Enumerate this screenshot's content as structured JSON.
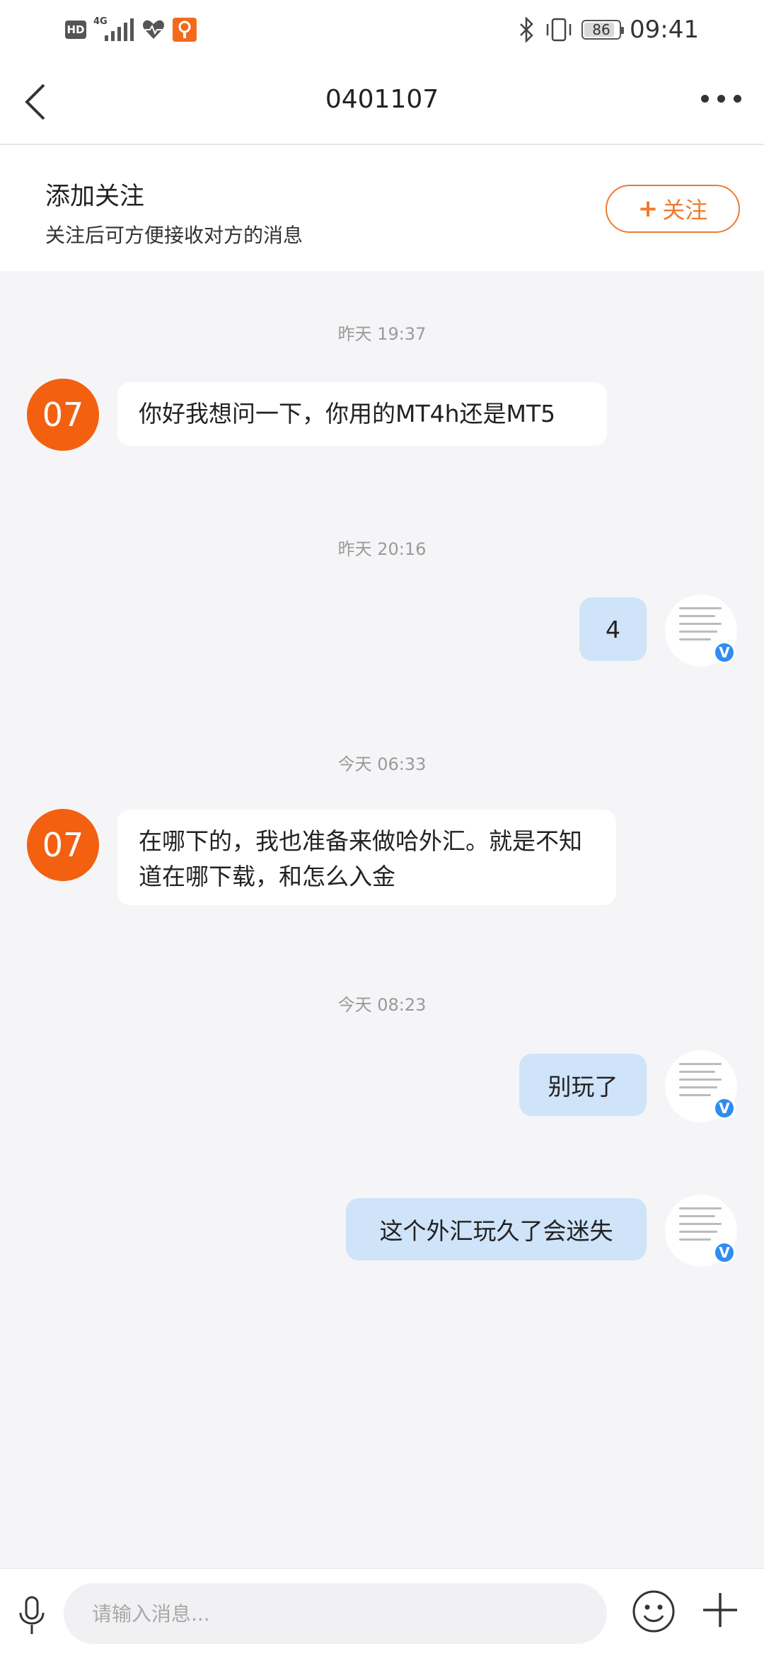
{
  "status_bar": {
    "hd_label": "HD",
    "network_label": "4G",
    "battery_level": "86",
    "time": "09:41"
  },
  "header": {
    "title": "0401107",
    "back_icon": "back-arrow-icon",
    "more_icon": "more-dots-icon"
  },
  "follow_card": {
    "title": "添加关注",
    "subtitle": "关注后可方便接收对方的消息",
    "button_plus": "+",
    "button_label": "关注"
  },
  "colors": {
    "accent": "#f07a2c",
    "avatar": "#f26010",
    "outgoing_bubble": "#cfe3f9",
    "verified_badge": "#2f8df0"
  },
  "messages": [
    {
      "time": "昨天 19:37",
      "from": "other",
      "avatar_text": "07",
      "text": "你好我想问一下，你用的MT4h还是MT5"
    },
    {
      "time": "昨天 20:16",
      "from": "me",
      "text": "4",
      "badge": "V"
    },
    {
      "time": "今天 06:33",
      "from": "other",
      "avatar_text": "07",
      "text": "在哪下的，我也准备来做哈外汇。就是不知道在哪下载，和怎么入金"
    },
    {
      "time": "今天 08:23",
      "from": "me",
      "text": "别玩了",
      "badge": "V"
    },
    {
      "from": "me",
      "text": "这个外汇玩久了会迷失",
      "badge": "V"
    }
  ],
  "input_bar": {
    "placeholder": "请输入消息...",
    "mic_icon": "microphone-icon",
    "emoji_icon": "emoji-icon",
    "plus_icon": "plus-icon"
  }
}
